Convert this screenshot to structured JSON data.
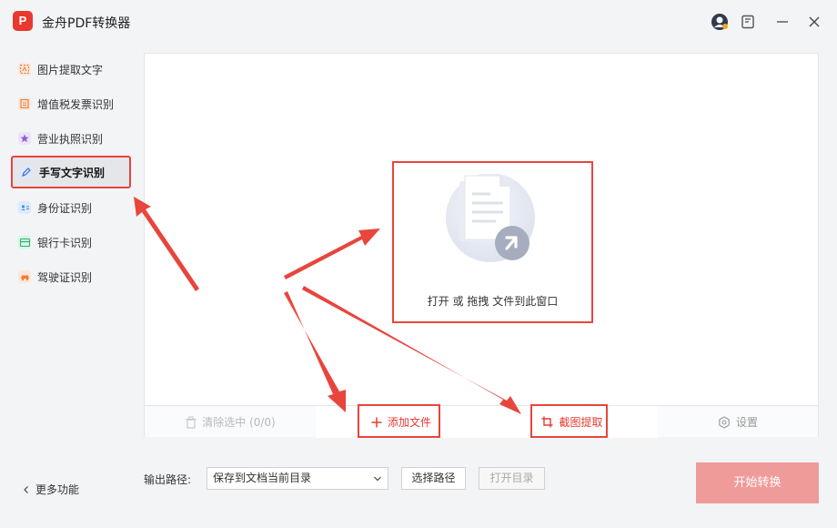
{
  "app": {
    "logo_text": "P",
    "title": "金舟PDF转换器"
  },
  "titlebar_icons": [
    "avatar-icon",
    "feedback-icon",
    "minimize-icon",
    "close-icon"
  ],
  "sidebar": {
    "items": [
      {
        "label": "图片提取文字",
        "icon": "image-text-icon",
        "color": "#f07c3a"
      },
      {
        "label": "增值税发票识别",
        "icon": "invoice-icon",
        "color": "#f07c3a"
      },
      {
        "label": "营业执照识别",
        "icon": "license-star-icon",
        "color": "#8a63d2"
      },
      {
        "label": "手写文字识别",
        "icon": "pen-icon",
        "color": "#3a6fd8",
        "active": true
      },
      {
        "label": "身份证识别",
        "icon": "id-card-icon",
        "color": "#3a8fe8"
      },
      {
        "label": "银行卡识别",
        "icon": "bank-card-icon",
        "color": "#2cb36b"
      },
      {
        "label": "驾驶证识别",
        "icon": "car-icon",
        "color": "#f07c3a"
      }
    ],
    "more_label": "更多功能"
  },
  "dropzone": {
    "label": "打开 或 拖拽 文件到此窗口"
  },
  "toolbar": {
    "clear_label": "清除选中 (0/0)",
    "add_label": "添加文件",
    "crop_label": "截图提取",
    "settings_label": "设置"
  },
  "output": {
    "label": "输出路径:",
    "selected": "保存到文档当前目录",
    "choose_label": "选择路径",
    "open_label": "打开目录"
  },
  "start_label": "开始转换",
  "colors": {
    "accent": "#e8392f",
    "highlight": "#e8453c",
    "start_button": "#ee9b99"
  }
}
